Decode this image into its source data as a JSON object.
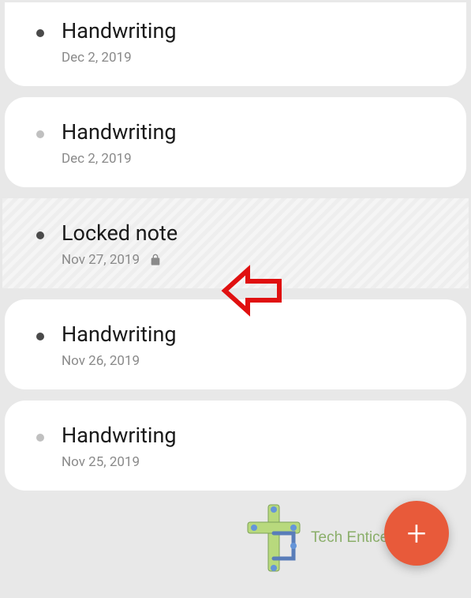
{
  "notes": [
    {
      "title": "Handwriting",
      "date": "Dec 2, 2019",
      "locked": false,
      "bullet": "dark",
      "selected": false,
      "first": true
    },
    {
      "title": "Handwriting",
      "date": "Dec 2, 2019",
      "locked": false,
      "bullet": "light",
      "selected": false,
      "first": false
    },
    {
      "title": "Locked note",
      "date": "Nov 27, 2019",
      "locked": true,
      "bullet": "dark",
      "selected": true,
      "first": false
    },
    {
      "title": "Handwriting",
      "date": "Nov 26, 2019",
      "locked": false,
      "bullet": "dark",
      "selected": false,
      "first": false
    },
    {
      "title": "Handwriting",
      "date": "Nov 25, 2019",
      "locked": false,
      "bullet": "light",
      "selected": false,
      "first": false
    }
  ],
  "fab": {
    "label": "+"
  },
  "watermark": {
    "text": "Tech Entice"
  }
}
